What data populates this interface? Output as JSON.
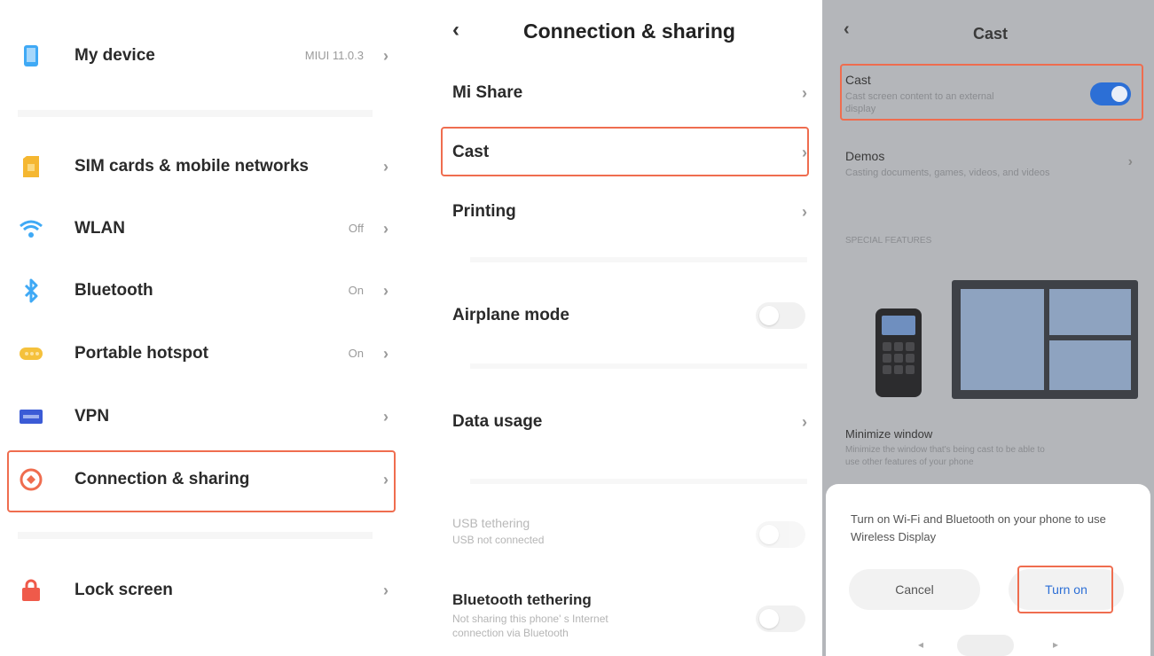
{
  "settings_panel": {
    "items": [
      {
        "label": "My device",
        "value": "MIUI 11.0.3",
        "icon": "phone-icon",
        "color": "#3fa9f5"
      },
      {
        "label": "SIM cards & mobile networks",
        "value": "",
        "icon": "sim-card-icon",
        "color": "#f5b731"
      },
      {
        "label": "WLAN",
        "value": "Off",
        "icon": "wifi-icon",
        "color": "#3fa9f5"
      },
      {
        "label": "Bluetooth",
        "value": "On",
        "icon": "bluetooth-icon",
        "color": "#3fa9f5"
      },
      {
        "label": "Portable hotspot",
        "value": "On",
        "icon": "hotspot-icon",
        "color": "#f5c13c"
      },
      {
        "label": "VPN",
        "value": "",
        "icon": "vpn-icon",
        "color": "#3b5bd6"
      },
      {
        "label": "Connection & sharing",
        "value": "",
        "icon": "connection-sharing-icon",
        "color": "#ef6d4f"
      },
      {
        "label": "Lock screen",
        "value": "",
        "icon": "lock-icon",
        "color": "#ef5a4a"
      }
    ],
    "chevron": "›"
  },
  "connection_panel": {
    "back": "‹",
    "title": "Connection & sharing",
    "items": {
      "mi_share": "Mi Share",
      "cast": "Cast",
      "printing": "Printing",
      "airplane": "Airplane mode",
      "data_usage": "Data usage",
      "usb_tethering": "USB tethering",
      "usb_tethering_sub": "USB not connected",
      "bt_tethering": "Bluetooth tethering",
      "bt_tethering_sub_1": "Not sharing this phone' s Internet",
      "bt_tethering_sub_2": "connection via Bluetooth"
    }
  },
  "cast_panel": {
    "back": "‹",
    "title": "Cast",
    "cast_label": "Cast",
    "cast_sub_1": "Cast screen content to an external",
    "cast_sub_2": "display",
    "cast_enabled": true,
    "demo_label": "Demos",
    "demo_sub": "Casting documents, games, videos, and videos",
    "section_header": "SPECIAL FEATURES",
    "minimize_label": "Minimize window",
    "minimize_sub_1": "Minimize the window that's being cast to be able to",
    "minimize_sub_2": "use other features of your phone",
    "dialog": {
      "message": "Turn on Wi-Fi and Bluetooth on your phone to use Wireless Display",
      "cancel": "Cancel",
      "turn_on": "Turn on"
    }
  },
  "colors": {
    "highlight": "#ef6d4f",
    "accent_blue": "#2c6fd6"
  }
}
